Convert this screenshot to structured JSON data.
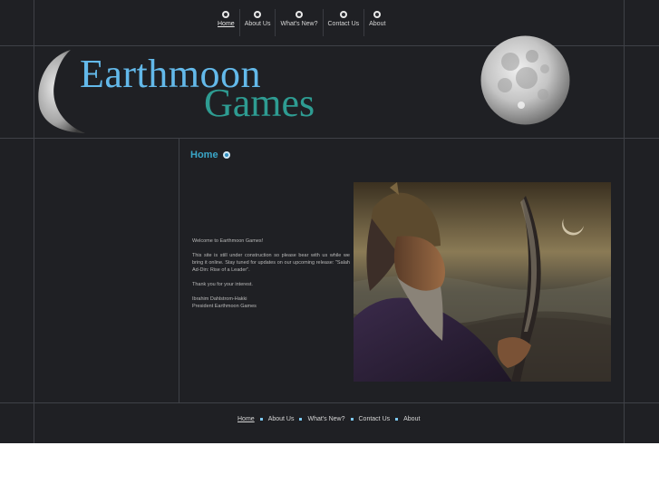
{
  "nav": {
    "items": [
      {
        "label": "Home"
      },
      {
        "label": "About Us"
      },
      {
        "label": "What's New?"
      },
      {
        "label": "Contact Us"
      },
      {
        "label": "About"
      }
    ],
    "active": "Home"
  },
  "header": {
    "logo_line1": "Earthmoon",
    "logo_line2": "Games"
  },
  "main": {
    "heading": "Home",
    "welcome": "Welcome to Earthmoon Games!",
    "message": "This site is still under construction so please bear with us while we bring it online. Stay tuned for updates on our upcoming release: \"Salah Ad-Din: Rise of a Leader\".",
    "thanks": "Thank you for your interest.",
    "signature_name": "Ibrahim Dahlstrom-Hakki",
    "signature_title": "President Earthmoon Games"
  },
  "colors": {
    "background": "#1f2024",
    "logo_earthmoon": "#63b9ea",
    "logo_games": "#2e9c92",
    "heading": "#3aa7c9",
    "footer_bullet": "#7cc8f0"
  },
  "icons": [
    "crescent-moon-icon",
    "full-moon-icon",
    "radio-dot-icon",
    "square-bullet-icon"
  ]
}
